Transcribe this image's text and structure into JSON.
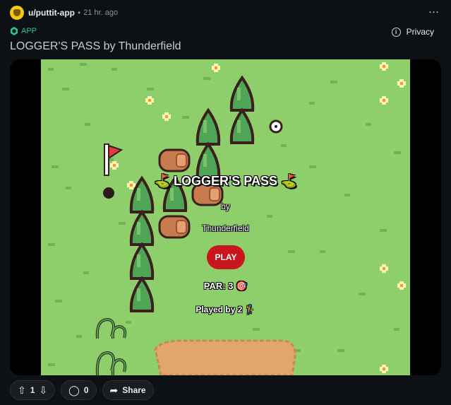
{
  "post": {
    "username": "u/puttit-app",
    "separator": "•",
    "time": "21 hr. ago",
    "app_label": "APP",
    "privacy_label": "Privacy",
    "title": "LOGGER'S PASS by Thunderfield"
  },
  "game": {
    "title": "LOGGER'S PASS",
    "title_flag_left": "⛳",
    "title_flag_right": "⛳",
    "by": "by",
    "author": "Thunderfield",
    "play_label": "PLAY",
    "par_text": "PAR: 3 🎯",
    "played_text": "Played by 2 🏌"
  },
  "actions": {
    "vote_count": "1",
    "comment_count": "0",
    "share_label": "Share"
  },
  "colors": {
    "grass": "#8ecf6c",
    "play_button": "#c8161d",
    "app_accent": "#27c39f",
    "sand": "#e2a66a"
  },
  "icons": [
    "more-icon",
    "app-icon",
    "info-icon",
    "upvote-icon",
    "downvote-icon",
    "comment-icon",
    "share-icon",
    "flag-icon",
    "golf-hole-icon"
  ]
}
